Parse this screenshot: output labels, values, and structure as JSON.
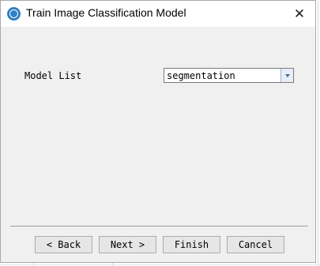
{
  "window": {
    "title": "Train Image Classification Model",
    "close_label": "✕"
  },
  "form": {
    "model_list_label": "Model List",
    "model_list_value": "segmentation"
  },
  "buttons": {
    "back": "< Back",
    "next": "Next >",
    "finish": "Finish",
    "cancel": "Cancel"
  },
  "icons": {
    "app_logo": "app-logo-icon",
    "dropdown": "chevron-down-icon",
    "close": "close-icon"
  },
  "colors": {
    "logo": "#2f7fc4",
    "dialog_bg": "#f0f0f0",
    "titlebar_bg": "#ffffff"
  }
}
